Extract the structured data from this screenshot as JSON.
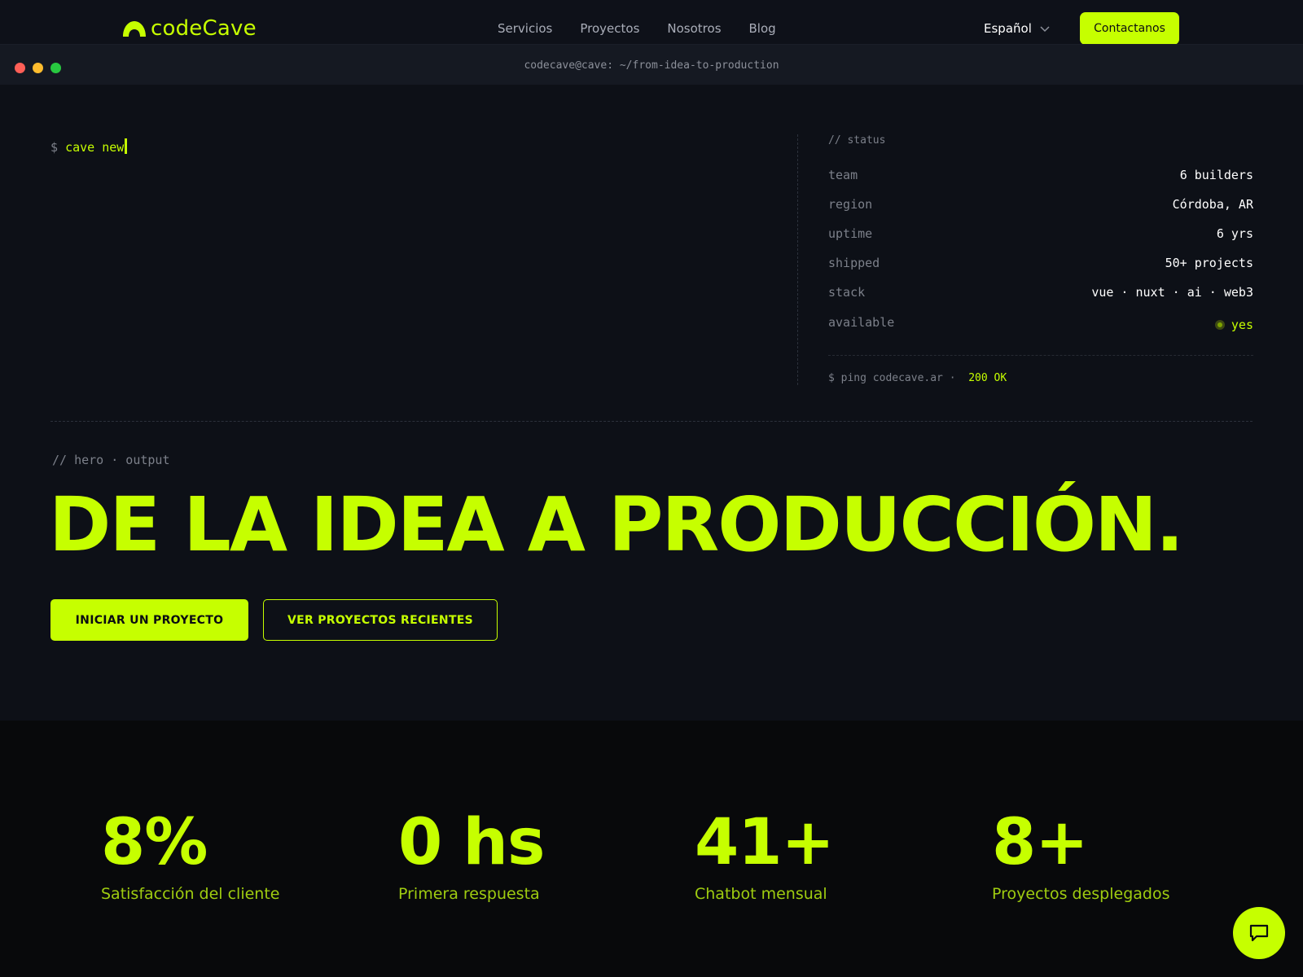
{
  "nav": {
    "logo_text": "codeCave",
    "links": [
      "Servicios",
      "Proyectos",
      "Nosotros",
      "Blog"
    ],
    "language": "Español",
    "contact_label": "Contactanos"
  },
  "terminal": {
    "path": "codecave@cave: ~/from-idea-to-production",
    "prompt_sigil": "$",
    "command": "cave new"
  },
  "status": {
    "title": "// status",
    "rows": [
      {
        "key": "team",
        "value": "6 builders"
      },
      {
        "key": "region",
        "value": "Córdoba, AR"
      },
      {
        "key": "uptime",
        "value": "6 yrs"
      },
      {
        "key": "shipped",
        "value": "50+ projects"
      },
      {
        "key": "stack",
        "value": "vue · nuxt · ai · web3"
      }
    ],
    "available_key": "available",
    "available_value": "yes",
    "ping_command": "$ ping codecave.ar  ·",
    "ping_result": "200 OK"
  },
  "hero": {
    "label": "// hero · output",
    "title": "DE LA IDEA A PRODUCCIÓN.",
    "primary_cta": "INICIAR UN PROYECTO",
    "secondary_cta": "VER PROYECTOS RECIENTES"
  },
  "stats": [
    {
      "value": "8%",
      "label": "Satisfacción del cliente"
    },
    {
      "value": "0 hs",
      "label": "Primera respuesta"
    },
    {
      "value": "41+",
      "label": "Chatbot mensual"
    },
    {
      "value": "8+",
      "label": "Proyectos desplegados"
    }
  ],
  "colors": {
    "accent": "#c6ff00",
    "background": "#0d1017",
    "stats_background": "#08090b"
  },
  "icons": {
    "logo": "cave-arch-icon",
    "language": "chevron-down-icon",
    "chat": "chat-bubble-icon"
  }
}
